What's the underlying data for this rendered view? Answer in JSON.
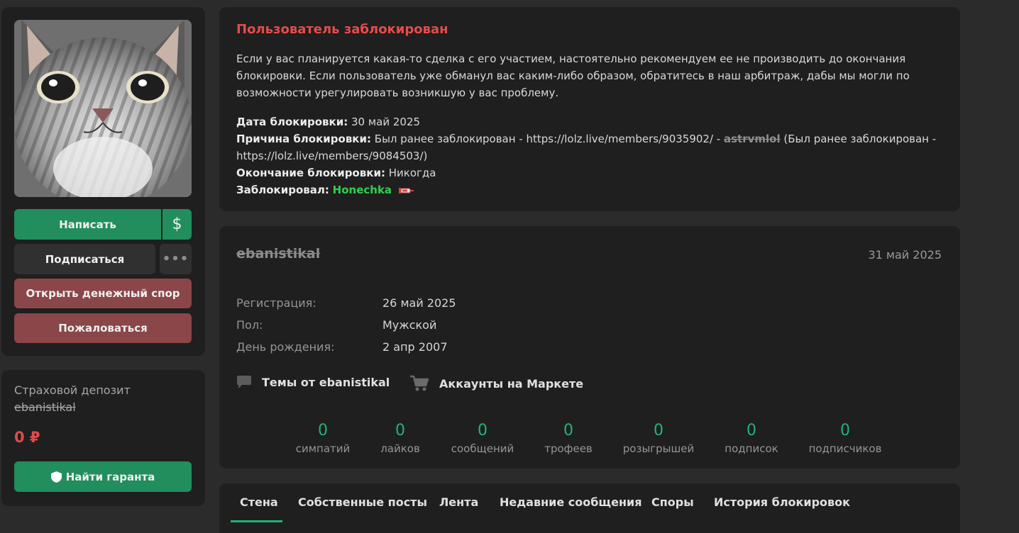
{
  "sidebar": {
    "write_label": "Написать",
    "dollar_label": "$",
    "subscribe_label": "Подписаться",
    "more_label": "•••",
    "dispute_label": "Открыть денежный спор",
    "report_label": "Пожаловаться"
  },
  "deposit": {
    "title": "Страховой депозит",
    "username": "ebanistikal",
    "amount": "0 ₽",
    "guarantor_label": "Найти гаранта",
    "guarantor_icon": "shield-icon"
  },
  "ban": {
    "title": "Пользователь заблокирован",
    "text": "Если у вас планируется какая-то сделка с его участием, настоятельно рекомендуем ее не производить до окончания блокировки. Если пользователь уже обманул вас каким-либо образом, обратитесь в наш арбитраж, дабы мы могли по возможности урегулировать возникшую у вас проблему.",
    "date_label": "Дата блокировки:",
    "date_value": "30 май 2025",
    "reason_label": "Причина блокировки:",
    "reason_part1": "Был ранее заблокирован - https://lolz.live/members/9035902/ -",
    "reason_struck": "astrvmlol",
    "reason_part2": "(Был ранее заблокирован - https://lolz.live/members/9084503/)",
    "end_label": "Окончание блокировки:",
    "end_value": "Никогда",
    "by_label": "Заблокировал:",
    "by_value": "Honechka"
  },
  "profile": {
    "username": "ebanistikal",
    "last_seen": "31 май 2025",
    "fields": [
      {
        "label": "Регистрация:",
        "value": "26 май 2025"
      },
      {
        "label": "Пол:",
        "value": "Мужской"
      },
      {
        "label": "День рождения:",
        "value": "2 апр 2007"
      }
    ],
    "threads_link": "Темы от ebanistikal",
    "market_link": "Аккаунты на Маркете",
    "stats": [
      {
        "value": "0",
        "label": "симпатий"
      },
      {
        "value": "0",
        "label": "лайков"
      },
      {
        "value": "0",
        "label": "сообщений"
      },
      {
        "value": "0",
        "label": "трофеев"
      },
      {
        "value": "0",
        "label": "розыгрышей"
      },
      {
        "value": "0",
        "label": "подписок"
      },
      {
        "value": "0",
        "label": "подписчиков"
      }
    ]
  },
  "tabs": [
    "Стена",
    "Собственные посты",
    "Лента",
    "Недавние сообщения",
    "Споры",
    "История блокировок"
  ],
  "colors": {
    "accent_green": "#22b374",
    "button_green": "#228e5d",
    "danger_red": "#e84b4b",
    "button_red": "#8a4648"
  }
}
